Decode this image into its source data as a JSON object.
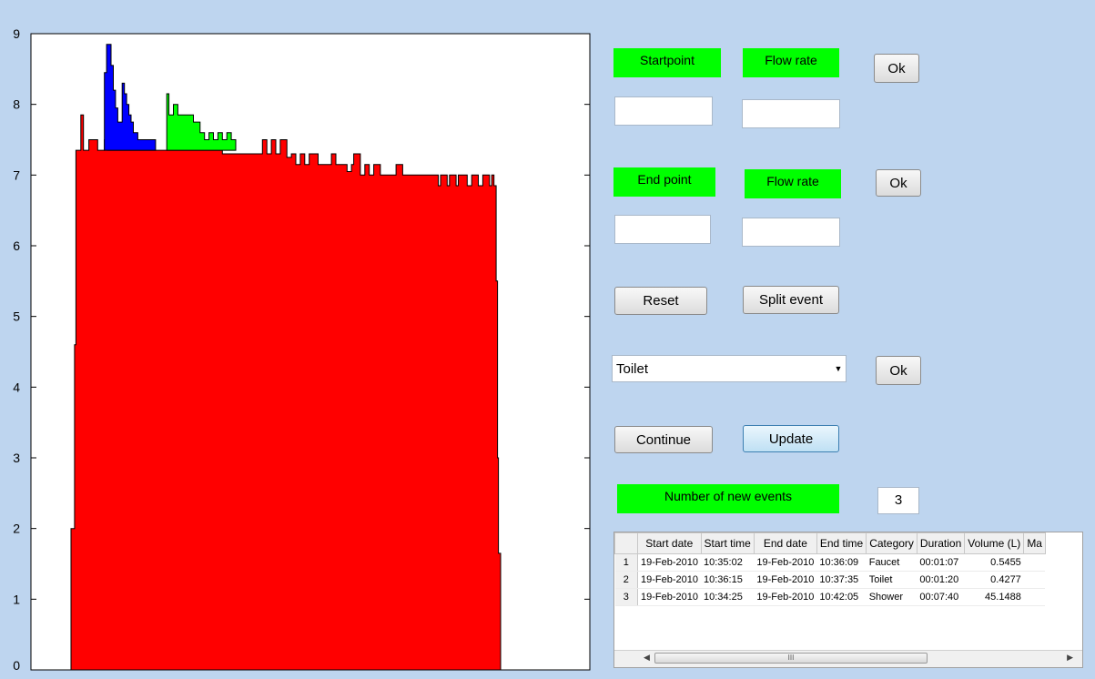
{
  "chart_data": {
    "type": "area",
    "title": "",
    "xlabel": "",
    "ylabel": "",
    "ylim": [
      0,
      9
    ],
    "y_ticks": [
      "0",
      "1",
      "2",
      "3",
      "4",
      "5",
      "6",
      "7",
      "8",
      "9"
    ],
    "grid": false,
    "series": [
      {
        "color": "#ff0000",
        "points": [
          [
            0,
            0
          ],
          [
            0,
            2.0
          ],
          [
            0.8,
            2.0
          ],
          [
            0.8,
            4.6
          ],
          [
            1.1,
            4.6
          ],
          [
            1.1,
            7.35
          ],
          [
            2.2,
            7.35
          ],
          [
            2.2,
            7.85
          ],
          [
            2.8,
            7.85
          ],
          [
            2.8,
            7.35
          ],
          [
            4.0,
            7.35
          ],
          [
            4.0,
            7.5
          ],
          [
            6.0,
            7.5
          ],
          [
            6.0,
            7.35
          ],
          [
            7.5,
            7.35
          ],
          [
            7.5,
            7.5
          ],
          [
            8.2,
            7.5
          ],
          [
            8.2,
            7.35
          ],
          [
            33,
            7.35
          ],
          [
            33,
            7.35
          ],
          [
            34,
            7.35
          ],
          [
            34,
            7.3
          ],
          [
            43,
            7.3
          ],
          [
            43,
            7.5
          ],
          [
            44,
            7.5
          ],
          [
            44,
            7.3
          ],
          [
            45,
            7.3
          ],
          [
            45,
            7.5
          ],
          [
            46,
            7.5
          ],
          [
            46,
            7.3
          ],
          [
            47,
            7.3
          ],
          [
            47,
            7.5
          ],
          [
            48.5,
            7.5
          ],
          [
            48.5,
            7.25
          ],
          [
            49.5,
            7.25
          ],
          [
            49.5,
            7.3
          ],
          [
            50.5,
            7.3
          ],
          [
            50.5,
            7.15
          ],
          [
            51.5,
            7.15
          ],
          [
            51.5,
            7.3
          ],
          [
            52.5,
            7.3
          ],
          [
            52.5,
            7.15
          ],
          [
            53.5,
            7.15
          ],
          [
            53.5,
            7.3
          ],
          [
            55.5,
            7.3
          ],
          [
            55.5,
            7.15
          ],
          [
            58.5,
            7.15
          ],
          [
            58.5,
            7.3
          ],
          [
            59.5,
            7.3
          ],
          [
            59.5,
            7.15
          ],
          [
            62,
            7.15
          ],
          [
            62,
            7.05
          ],
          [
            63,
            7.05
          ],
          [
            63,
            7.15
          ],
          [
            63.5,
            7.15
          ],
          [
            63.5,
            7.3
          ],
          [
            65,
            7.3
          ],
          [
            65,
            7.0
          ],
          [
            66,
            7.0
          ],
          [
            66,
            7.15
          ],
          [
            67,
            7.15
          ],
          [
            67,
            7.0
          ],
          [
            68,
            7.0
          ],
          [
            68,
            7.15
          ],
          [
            69.5,
            7.15
          ],
          [
            69.5,
            7.0
          ],
          [
            73,
            7.0
          ],
          [
            73,
            7.15
          ],
          [
            74.5,
            7.15
          ],
          [
            74.5,
            7.0
          ],
          [
            82.5,
            7.0
          ],
          [
            82.5,
            6.85
          ],
          [
            83,
            6.85
          ],
          [
            83,
            7.0
          ],
          [
            84.5,
            7.0
          ],
          [
            84.5,
            6.85
          ],
          [
            85,
            6.85
          ],
          [
            85,
            7.0
          ],
          [
            86.5,
            7.0
          ],
          [
            86.5,
            6.85
          ],
          [
            87,
            6.85
          ],
          [
            87,
            7.0
          ],
          [
            89,
            7.0
          ],
          [
            89,
            6.85
          ],
          [
            90,
            6.85
          ],
          [
            90,
            7.0
          ],
          [
            91.5,
            7.0
          ],
          [
            91.5,
            6.85
          ],
          [
            92.5,
            6.85
          ],
          [
            92.5,
            7.0
          ],
          [
            94,
            7.0
          ],
          [
            94,
            6.85
          ],
          [
            94.5,
            6.85
          ],
          [
            94.5,
            7.0
          ],
          [
            95,
            7.0
          ],
          [
            95,
            6.85
          ],
          [
            95.5,
            6.85
          ],
          [
            95.5,
            5.5
          ],
          [
            95.8,
            5.5
          ],
          [
            95.8,
            3.0
          ],
          [
            96,
            3.0
          ],
          [
            96,
            1.65
          ],
          [
            96.5,
            1.65
          ],
          [
            96.5,
            0
          ]
        ]
      },
      {
        "color": "#0000ff",
        "points": [
          [
            7.5,
            7.35
          ],
          [
            7.5,
            8.45
          ],
          [
            8,
            8.45
          ],
          [
            8,
            8.85
          ],
          [
            9,
            8.85
          ],
          [
            9,
            8.55
          ],
          [
            9.5,
            8.55
          ],
          [
            9.5,
            8.2
          ],
          [
            10,
            8.2
          ],
          [
            10,
            7.95
          ],
          [
            10.5,
            7.95
          ],
          [
            10.5,
            7.75
          ],
          [
            11.5,
            7.75
          ],
          [
            11.5,
            8.3
          ],
          [
            12,
            8.3
          ],
          [
            12,
            8.15
          ],
          [
            12.5,
            8.15
          ],
          [
            12.5,
            8.0
          ],
          [
            13,
            8.0
          ],
          [
            13,
            7.85
          ],
          [
            13.5,
            7.85
          ],
          [
            13.5,
            7.75
          ],
          [
            14,
            7.75
          ],
          [
            14,
            7.6
          ],
          [
            15,
            7.6
          ],
          [
            15,
            7.5
          ],
          [
            19,
            7.5
          ],
          [
            19,
            7.35
          ]
        ]
      },
      {
        "color": "#00ff00",
        "points": [
          [
            21.5,
            7.35
          ],
          [
            21.5,
            8.15
          ],
          [
            22,
            8.15
          ],
          [
            22,
            7.85
          ],
          [
            23,
            7.85
          ],
          [
            23,
            8.0
          ],
          [
            24,
            8.0
          ],
          [
            24,
            7.85
          ],
          [
            27.5,
            7.85
          ],
          [
            27.5,
            7.75
          ],
          [
            29,
            7.75
          ],
          [
            29,
            7.6
          ],
          [
            30,
            7.6
          ],
          [
            30,
            7.5
          ],
          [
            31,
            7.5
          ],
          [
            31,
            7.6
          ],
          [
            32,
            7.6
          ],
          [
            32,
            7.5
          ],
          [
            33,
            7.5
          ],
          [
            33,
            7.6
          ],
          [
            34,
            7.6
          ],
          [
            34,
            7.5
          ],
          [
            35,
            7.5
          ],
          [
            35,
            7.6
          ],
          [
            36,
            7.6
          ],
          [
            36,
            7.5
          ],
          [
            37,
            7.5
          ],
          [
            37,
            7.35
          ]
        ]
      }
    ]
  },
  "controls": {
    "startpoint_label": "Startpoint",
    "start_flow_label": "Flow rate",
    "endpoint_label": "End point",
    "end_flow_label": "Flow rate",
    "ok1": "Ok",
    "ok2": "Ok",
    "ok3": "Ok",
    "startpoint_value": "",
    "start_flow_value": "",
    "endpoint_value": "",
    "end_flow_value": "",
    "reset": "Reset",
    "split": "Split event",
    "category_selected": "Toilet",
    "continue": "Continue",
    "update": "Update",
    "num_events_label": "Number of new events",
    "num_events_value": "3"
  },
  "table": {
    "columns": [
      "Start date",
      "Start time",
      "End date",
      "End time",
      "Category",
      "Duration",
      "Volume (L)",
      "Ma"
    ],
    "rows": [
      {
        "idx": "1",
        "cells": [
          "19-Feb-2010",
          "10:35:02",
          "19-Feb-2010",
          "10:36:09",
          "Faucet",
          "00:01:07",
          "0.5455",
          ""
        ]
      },
      {
        "idx": "2",
        "cells": [
          "19-Feb-2010",
          "10:36:15",
          "19-Feb-2010",
          "10:37:35",
          "Toilet",
          "00:01:20",
          "0.4277",
          ""
        ]
      },
      {
        "idx": "3",
        "cells": [
          "19-Feb-2010",
          "10:34:25",
          "19-Feb-2010",
          "10:42:05",
          "Shower",
          "00:07:40",
          "45.1488",
          ""
        ]
      }
    ],
    "scroll_left_icon": "◀",
    "scroll_right_icon": "▶",
    "thumb_grip": "III"
  }
}
